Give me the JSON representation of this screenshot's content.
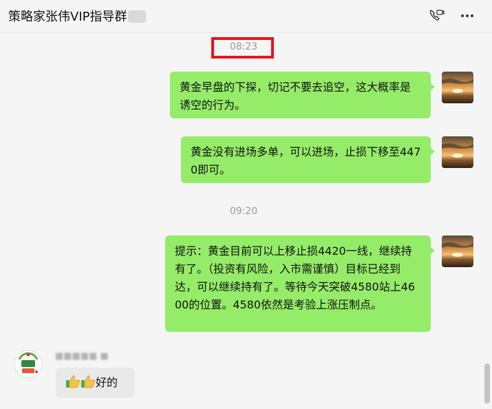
{
  "header": {
    "title": "策略家张伟VIP指导群",
    "call_icon": "video-call-icon",
    "more_icon": "more-dots-icon"
  },
  "timestamps": [
    "08:23",
    "09:20"
  ],
  "messages": [
    {
      "side": "right",
      "text": "黄金早盘的下探，切记不要去追空，这大概率是诱空的行为。"
    },
    {
      "side": "right",
      "text": "黄金没有进场多单，可以进场，止损下移至4470即可。"
    },
    {
      "side": "right",
      "text": "提示：黄金目前可以上移止损4420一线，继续持有了。（投资有风险，入市需谨慎）目标已经到达，可以继续持有了。等待今天突破4580站上4600的位置。4580依然是考验上涨压制点。"
    },
    {
      "side": "left",
      "text": "好的",
      "emoji": [
        "thumbs-up-icon",
        "thumbs-up-icon"
      ]
    }
  ],
  "colors": {
    "own_bubble": "#95ec69",
    "other_bubble": "#e9e9e9",
    "highlight_box": "#e8141a"
  }
}
